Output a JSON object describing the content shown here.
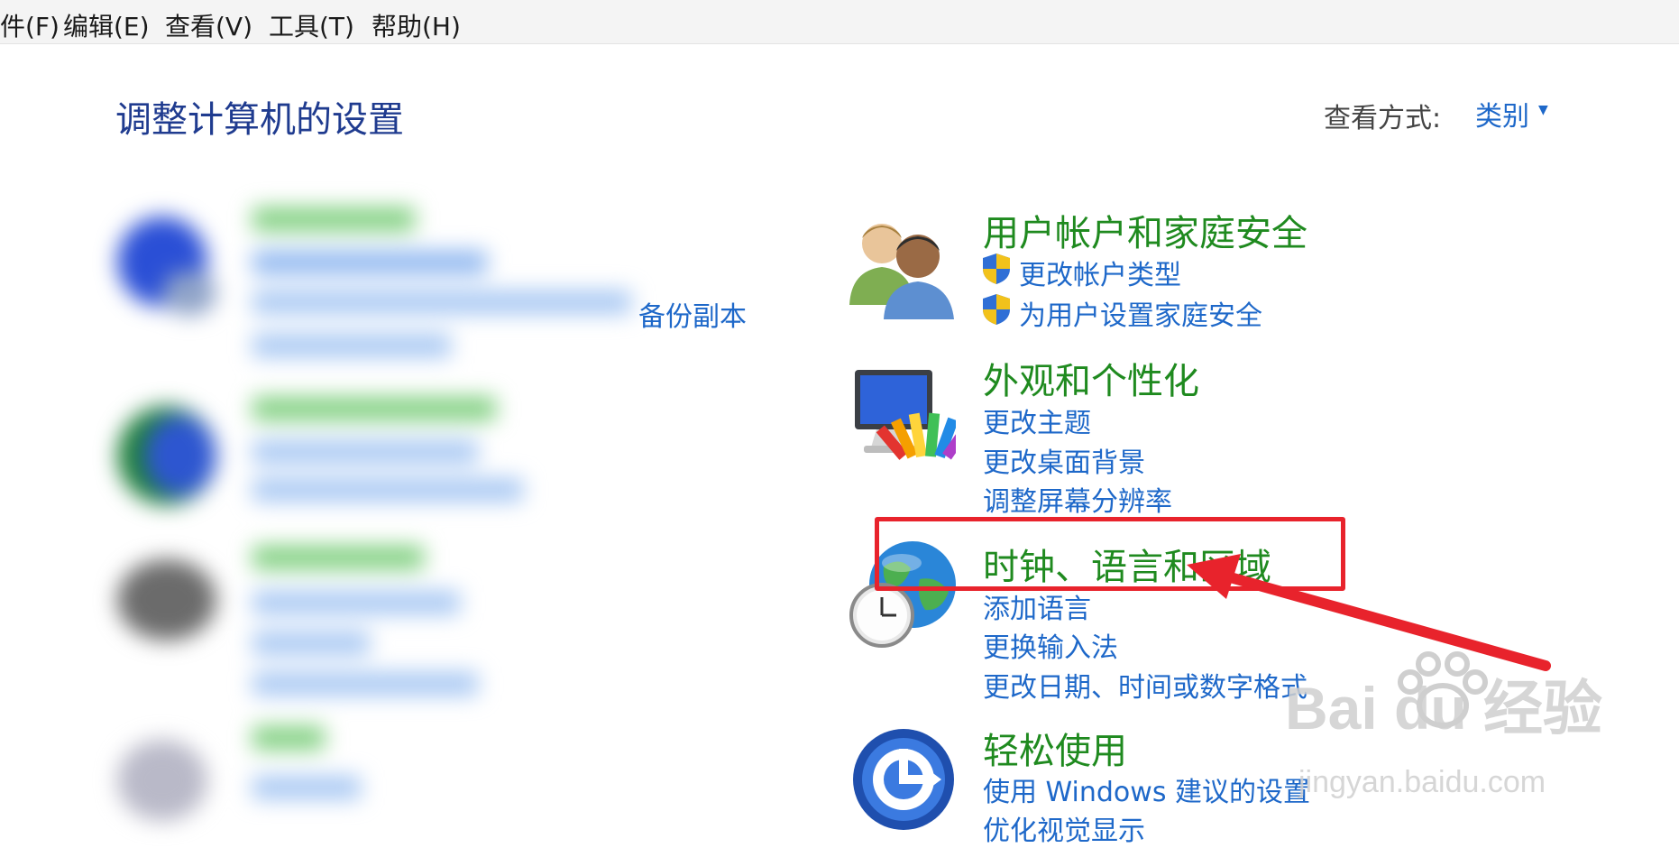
{
  "menu": {
    "file": "件(F)",
    "edit": "编辑(E)",
    "view": "查看(V)",
    "tools": "工具(T)",
    "help": "帮助(H)"
  },
  "header": {
    "title": "调整计算机的设置",
    "view_by_label": "查看方式:",
    "view_by_value": "类别"
  },
  "left_column": {
    "visible_fragment": "备份副本"
  },
  "categories": [
    {
      "title": "用户帐户和家庭安全",
      "icon": "users-icon",
      "links": [
        "更改帐户类型",
        "为用户设置家庭安全"
      ]
    },
    {
      "title": "外观和个性化",
      "icon": "monitor-palette-icon",
      "links": [
        "更改主题",
        "更改桌面背景",
        "调整屏幕分辨率"
      ]
    },
    {
      "title": "时钟、语言和区域",
      "icon": "globe-clock-icon",
      "links": [
        "添加语言",
        "更换输入法",
        "更改日期、时间或数字格式"
      ]
    },
    {
      "title": "轻松使用",
      "icon": "ease-of-access-icon",
      "links": [
        "使用 Windows 建议的设置",
        "优化视觉显示"
      ]
    }
  ],
  "watermark": {
    "brand": "Bai du 经验",
    "url": "jingyan.baidu.com"
  },
  "colors": {
    "category_title": "#1f8a1f",
    "link": "#1e68c9",
    "page_title": "#1f3b8f",
    "highlight": "#e8232c"
  }
}
